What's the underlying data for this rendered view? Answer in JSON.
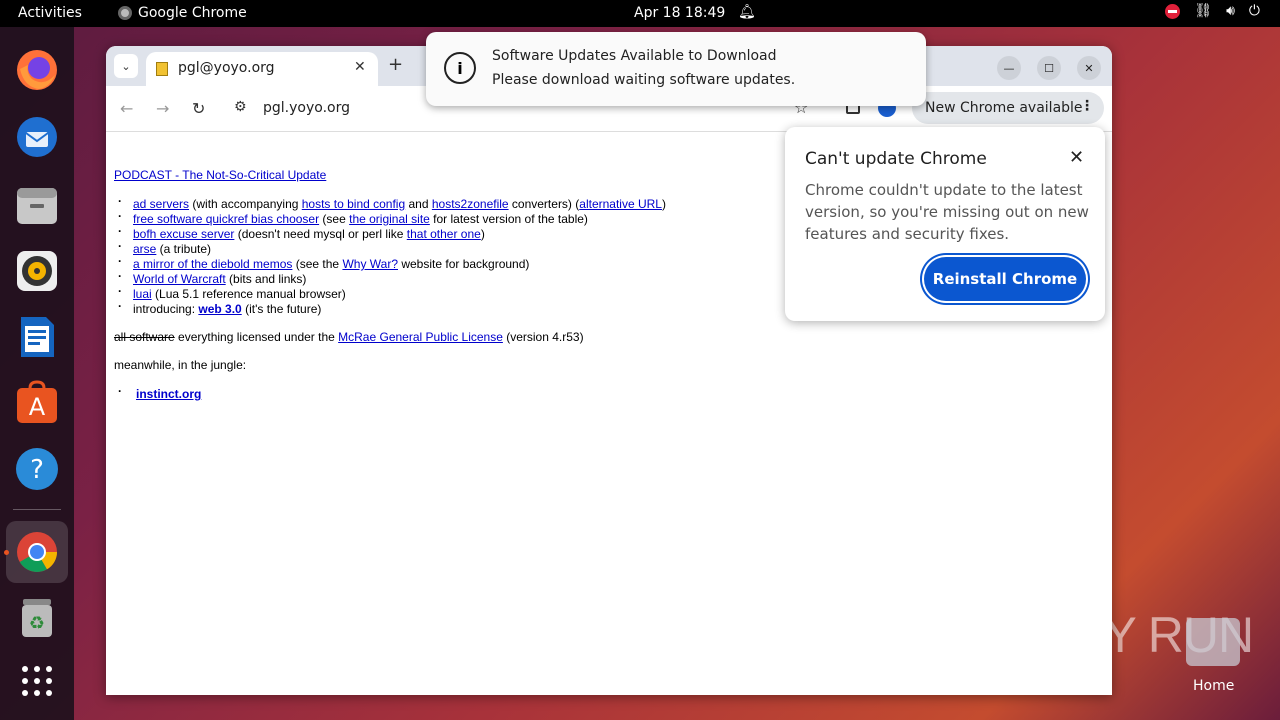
{
  "topbar": {
    "activities": "Activities",
    "app_name": "Google Chrome",
    "datetime": "Apr 18  18:49"
  },
  "dock": {
    "items": [
      "firefox-icon",
      "thunderbird-icon",
      "files-icon",
      "rhythmbox-icon",
      "writer-icon",
      "app-center-icon",
      "help-icon",
      "chrome-icon",
      "trash-icon",
      "show-apps-icon"
    ]
  },
  "browser": {
    "tab_title": "pgl@yoyo.org",
    "url": "pgl.yoyo.org",
    "new_chrome_label": "New Chrome available"
  },
  "page": {
    "podcast": "PODCAST - The Not-So-Critical Update",
    "items": [
      {
        "parts": [
          {
            "link": "ad servers"
          },
          {
            "text": " (with accompanying "
          },
          {
            "link": "hosts to bind config"
          },
          {
            "text": " and "
          },
          {
            "link": "hosts2zonefile"
          },
          {
            "text": " converters) ("
          },
          {
            "link": "alternative URL"
          },
          {
            "text": ")"
          }
        ]
      },
      {
        "parts": [
          {
            "link": "free software quickref bias chooser"
          },
          {
            "text": " (see "
          },
          {
            "link": "the original site"
          },
          {
            "text": " for latest version of the table)"
          }
        ]
      },
      {
        "parts": [
          {
            "link": "bofh excuse server"
          },
          {
            "text": " (doesn't need mysql or perl like "
          },
          {
            "link": "that other one"
          },
          {
            "text": ")"
          }
        ]
      },
      {
        "parts": [
          {
            "link": "arse"
          },
          {
            "text": " (a tribute)"
          }
        ]
      },
      {
        "parts": [
          {
            "link": "a mirror of the diebold memos"
          },
          {
            "text": " (see the "
          },
          {
            "link": "Why War?"
          },
          {
            "text": " website for background)"
          }
        ]
      },
      {
        "parts": [
          {
            "link": "World of Warcraft"
          },
          {
            "text": " (bits and links)"
          }
        ]
      },
      {
        "parts": [
          {
            "link": "luai"
          },
          {
            "text": " (Lua 5.1 reference manual browser)"
          }
        ]
      },
      {
        "parts": [
          {
            "text": "introducing: "
          },
          {
            "boldlink": "web 3.0"
          },
          {
            "text": " (it's the future)"
          }
        ]
      }
    ],
    "license_strike": "all software",
    "license_text": " everything licensed under the ",
    "license_link": "McRae General Public License",
    "license_version": " (version 4.r53)",
    "jungle": "meanwhile, in the jungle:",
    "instinct": "instinct.org"
  },
  "popup": {
    "title": "Can't update Chrome",
    "body": "Chrome couldn't update to the latest version, so you're missing out on new features and security fixes.",
    "button": "Reinstall Chrome"
  },
  "notification": {
    "title": "Software Updates Available to Download",
    "body": "Please download waiting software updates."
  },
  "desktop": {
    "watermark": "ANY RUN",
    "home_label": "Home"
  }
}
